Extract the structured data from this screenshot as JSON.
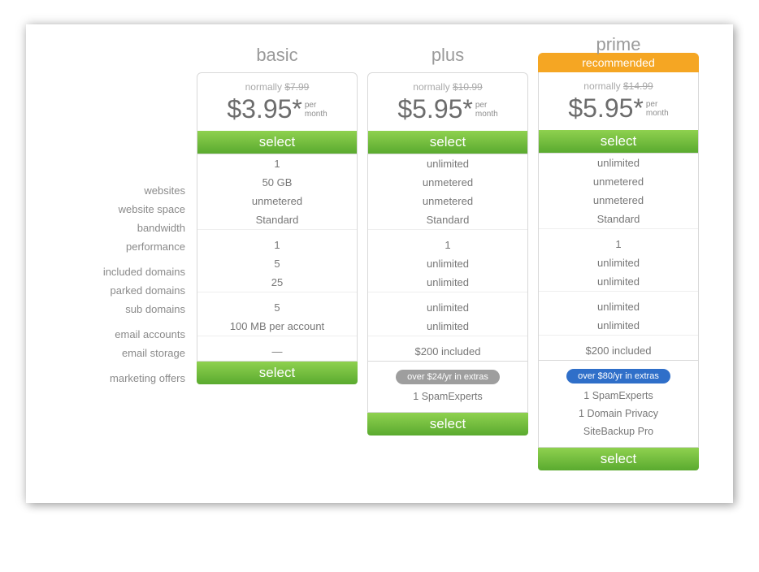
{
  "labels": {
    "websites": "websites",
    "website_space": "website space",
    "bandwidth": "bandwidth",
    "performance": "performance",
    "included_domains": "included domains",
    "parked_domains": "parked domains",
    "sub_domains": "sub domains",
    "email_accounts": "email accounts",
    "email_storage": "email storage",
    "marketing_offers": "marketing offers"
  },
  "common": {
    "normally_label": "normally",
    "per": "per",
    "month": "month",
    "select": "select",
    "recommended": "recommended"
  },
  "plans": {
    "basic": {
      "title": "basic",
      "old_price": "$7.99",
      "price": "$3.95*",
      "features": {
        "websites": "1",
        "website_space": "50 GB",
        "bandwidth": "unmetered",
        "performance": "Standard",
        "included_domains": "1",
        "parked_domains": "5",
        "sub_domains": "25",
        "email_accounts": "5",
        "email_storage": "100 MB per account",
        "marketing_offers": "—"
      }
    },
    "plus": {
      "title": "plus",
      "old_price": "$10.99",
      "price": "$5.95*",
      "features": {
        "websites": "unlimited",
        "website_space": "unmetered",
        "bandwidth": "unmetered",
        "performance": "Standard",
        "included_domains": "1",
        "parked_domains": "unlimited",
        "sub_domains": "unlimited",
        "email_accounts": "unlimited",
        "email_storage": "unlimited",
        "marketing_offers": "$200 included"
      },
      "extras_pill": "over $24/yr in extras",
      "extras": {
        "e1": "1 SpamExperts"
      }
    },
    "prime": {
      "title": "prime",
      "old_price": "$14.99",
      "price": "$5.95*",
      "features": {
        "websites": "unlimited",
        "website_space": "unmetered",
        "bandwidth": "unmetered",
        "performance": "Standard",
        "included_domains": "1",
        "parked_domains": "unlimited",
        "sub_domains": "unlimited",
        "email_accounts": "unlimited",
        "email_storage": "unlimited",
        "marketing_offers": "$200 included"
      },
      "extras_pill": "over $80/yr in extras",
      "extras": {
        "e1": "1 SpamExperts",
        "e2": "1 Domain Privacy",
        "e3": "SiteBackup Pro"
      }
    }
  }
}
